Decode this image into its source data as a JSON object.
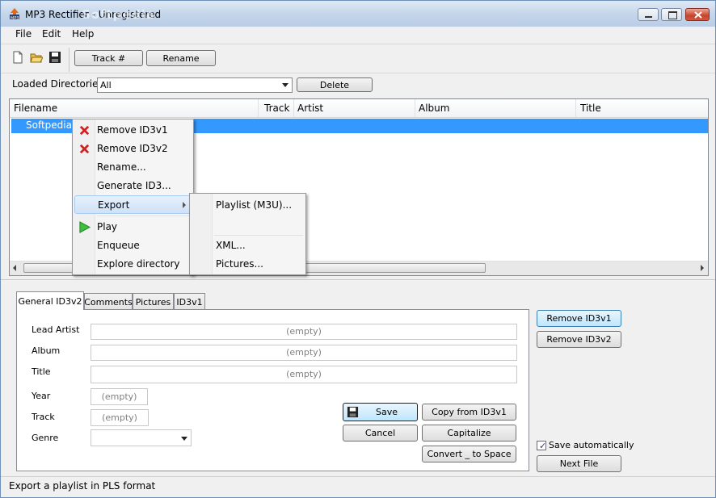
{
  "window": {
    "title": "MP3 Rectifier - Unregistered",
    "watermark": "Softpedia"
  },
  "menubar": {
    "items": [
      "File",
      "Edit",
      "Help"
    ]
  },
  "toolbar": {
    "track_button": "Track #",
    "rename_button": "Rename"
  },
  "directories": {
    "label": "Loaded Directories",
    "selected": "All",
    "delete_button": "Delete"
  },
  "listview": {
    "columns": [
      "Filename",
      "Track",
      "Artist",
      "Album",
      "Title"
    ],
    "rows": [
      {
        "filename": "Softpedia.m"
      }
    ]
  },
  "context_menu": {
    "items": [
      "Remove ID3v1",
      "Remove ID3v2",
      "Rename...",
      "Generate ID3...",
      "Export",
      "Play",
      "Enqueue",
      "Explore directory"
    ]
  },
  "submenu": {
    "items": [
      "Playlist (M3U)...",
      "XML...",
      "Pictures..."
    ]
  },
  "tabs": {
    "items": [
      "General ID3v2",
      "Comments",
      "Pictures",
      "ID3v1"
    ]
  },
  "form": {
    "lead_artist_label": "Lead Artist",
    "album_label": "Album",
    "title_label": "Title",
    "year_label": "Year",
    "track_label": "Track",
    "genre_label": "Genre",
    "empty_placeholder": "(empty)"
  },
  "actions": {
    "save": "Save",
    "cancel": "Cancel",
    "copy_from_id3v1": "Copy from ID3v1",
    "capitalize": "Capitalize",
    "convert": "Convert _ to Space",
    "remove_id3v1": "Remove ID3v1",
    "remove_id3v2": "Remove ID3v2",
    "save_auto_label": "Save automatically",
    "next_file": "Next File"
  },
  "status": {
    "text": "Export a playlist in PLS format"
  }
}
